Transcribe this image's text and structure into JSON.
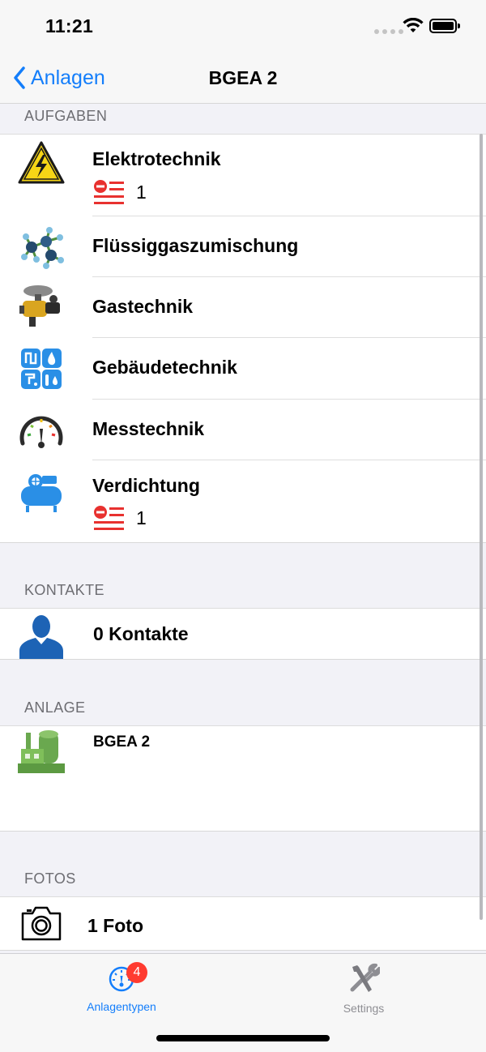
{
  "status_bar": {
    "time": "11:21"
  },
  "nav": {
    "back_label": "Anlagen",
    "title": "BGEA 2"
  },
  "sections": {
    "aufgaben": "AUFGABEN",
    "kontakte": "KONTAKTE",
    "anlage": "ANLAGE",
    "fotos": "FOTOS"
  },
  "aufgaben": [
    {
      "title": "Elektrotechnik",
      "icon": "high-voltage-warning-icon",
      "open_count": "1"
    },
    {
      "title": "Flüssiggaszumischung",
      "icon": "molecule-icon"
    },
    {
      "title": "Gastechnik",
      "icon": "gas-regulator-icon"
    },
    {
      "title": "Gebäudetechnik",
      "icon": "building-services-icon"
    },
    {
      "title": "Messtechnik",
      "icon": "gauge-icon"
    },
    {
      "title": "Verdichtung",
      "icon": "compressor-icon",
      "open_count": "1"
    }
  ],
  "kontakte": {
    "label": "0 Kontakte",
    "icon": "person-silhouette-icon"
  },
  "anlage": {
    "name": "BGEA 2",
    "icon": "biogas-plant-icon"
  },
  "fotos": {
    "label": "1 Foto",
    "icon": "camera-icon"
  },
  "tab_bar": {
    "tabs": [
      {
        "label": "Anlagentypen",
        "icon": "gauge-icon",
        "badge": "4",
        "active": true
      },
      {
        "label": "Settings",
        "icon": "tools-icon",
        "active": false
      }
    ]
  },
  "colors": {
    "accent": "#147efb",
    "badge": "#ff3b30",
    "task_red": "#e8312f"
  }
}
